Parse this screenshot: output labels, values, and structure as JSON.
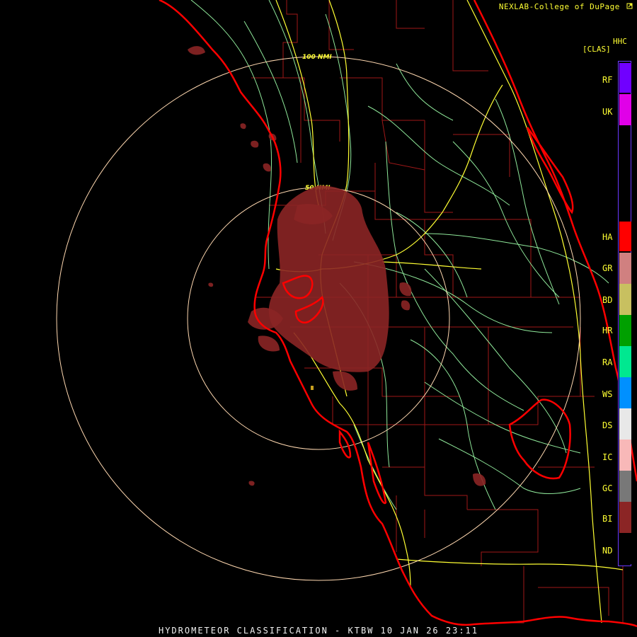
{
  "header": {
    "credit": "NEXLAB-College of DuPage",
    "credit_icon": "external-link-icon"
  },
  "product": {
    "code": "HHC",
    "units": "[CLAS]"
  },
  "legend": [
    {
      "label": "RF",
      "color": "#7000ff"
    },
    {
      "label": "UK",
      "color": "#e000e8"
    },
    {
      "label": "HA",
      "color": "#ff0000"
    },
    {
      "label": "GR",
      "color": "#d08080"
    },
    {
      "label": "BD",
      "color": "#c8c060"
    },
    {
      "label": "HR",
      "color": "#00a000"
    },
    {
      "label": "RA",
      "color": "#00e890"
    },
    {
      "label": "WS",
      "color": "#0090ff"
    },
    {
      "label": "DS",
      "color": "#e8e8e8"
    },
    {
      "label": "IC",
      "color": "#f8b8b8"
    },
    {
      "label": "GC",
      "color": "#787878"
    },
    {
      "label": "BI",
      "color": "#8b2525"
    },
    {
      "label": "ND",
      "color": "#000000"
    }
  ],
  "range_rings": [
    {
      "label": "100 NMI"
    },
    {
      "label": "50 NMI"
    }
  ],
  "caption": "HYDROMETEOR CLASSIFICATION - KTBW 10 JAN 26 23:11",
  "colors": {
    "coastline": "#ff0000",
    "county_lines": "#a01818",
    "highways": "#ffff33",
    "roads": "#8fe89a",
    "rings": "#ffd8b0",
    "echo": "#8b2525"
  }
}
